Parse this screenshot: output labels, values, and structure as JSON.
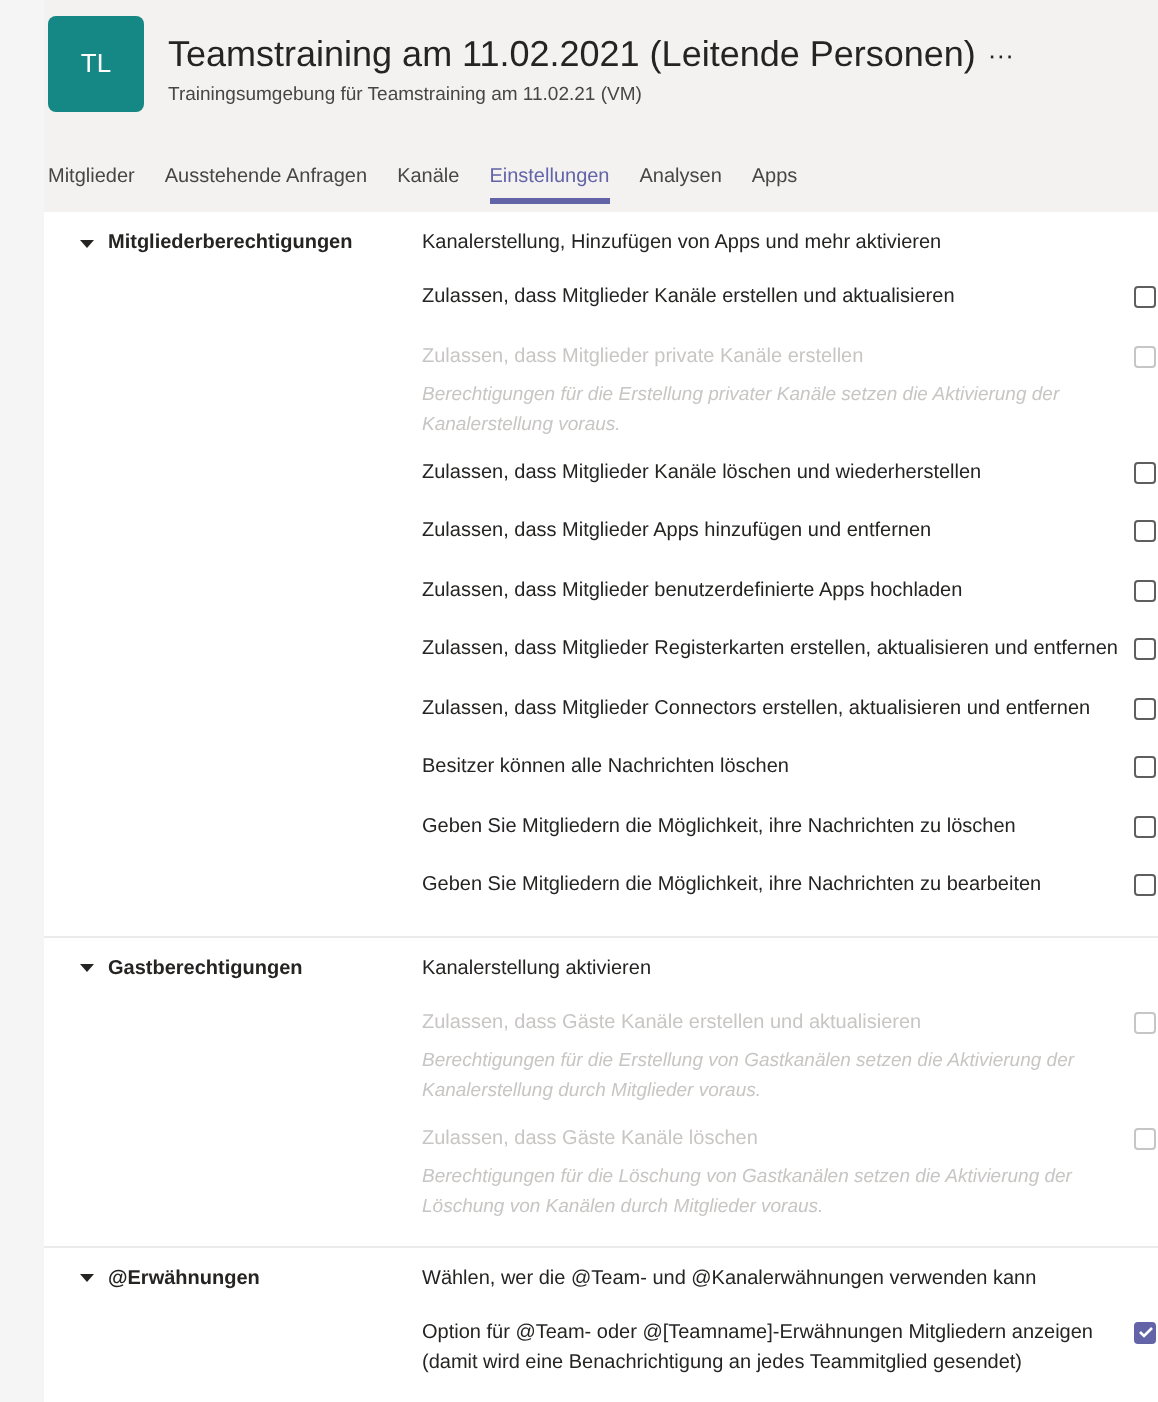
{
  "team": {
    "initials": "TL",
    "title": "Teamstraining am 11.02.2021 (Leitende Personen)",
    "more": "···",
    "subtitle": "Trainingsumgebung für Teamstraining am 11.02.21 (VM)"
  },
  "tabs": [
    {
      "label": "Mitglieder",
      "selected": false
    },
    {
      "label": "Ausstehende Anfragen",
      "selected": false
    },
    {
      "label": "Kanäle",
      "selected": false
    },
    {
      "label": "Einstellungen",
      "selected": true
    },
    {
      "label": "Analysen",
      "selected": false
    },
    {
      "label": "Apps",
      "selected": false
    }
  ],
  "sections": [
    {
      "title": "Mitgliederberechtigungen",
      "expanded": true,
      "description": "Kanalerstellung, Hinzufügen von Apps und mehr aktivieren",
      "settings": [
        {
          "label": "Zulassen, dass Mitglieder Kanäle erstellen und aktualisieren",
          "disabled": false,
          "checked": false
        },
        {
          "label": "Zulassen, dass Mitglieder private Kanäle erstellen",
          "note": "Berechtigungen für die Erstellung privater Kanäle setzen die Aktivierung der Kanalerstellung voraus.",
          "disabled": true,
          "checked": false
        },
        {
          "label": "Zulassen, dass Mitglieder Kanäle löschen und wiederherstellen",
          "disabled": false,
          "checked": false
        },
        {
          "label": "Zulassen, dass Mitglieder Apps hinzufügen und entfernen",
          "disabled": false,
          "checked": false
        },
        {
          "label": "Zulassen, dass Mitglieder benutzerdefinierte Apps hochladen",
          "disabled": false,
          "checked": false
        },
        {
          "label": "Zulassen, dass Mitglieder Registerkarten erstellen, aktualisieren und entfernen",
          "disabled": false,
          "checked": false
        },
        {
          "label": "Zulassen, dass Mitglieder Connectors erstellen, aktualisieren und entfernen",
          "disabled": false,
          "checked": false
        },
        {
          "label": "Besitzer können alle Nachrichten löschen",
          "disabled": false,
          "checked": false
        },
        {
          "label": "Geben Sie Mitgliedern die Möglichkeit, ihre Nachrichten zu löschen",
          "disabled": false,
          "checked": false
        },
        {
          "label": "Geben Sie Mitgliedern die Möglichkeit, ihre Nachrichten zu bearbeiten",
          "disabled": false,
          "checked": false
        }
      ]
    },
    {
      "title": "Gastberechtigungen",
      "expanded": true,
      "description": "Kanalerstellung aktivieren",
      "settings": [
        {
          "label": "Zulassen, dass Gäste Kanäle erstellen und aktualisieren",
          "note": "Berechtigungen für die Erstellung von Gastkanälen setzen die Aktivierung der Kanalerstellung durch Mitglieder voraus.",
          "disabled": true,
          "checked": false
        },
        {
          "label": "Zulassen, dass Gäste Kanäle löschen",
          "note": "Berechtigungen für die Löschung von Gastkanälen setzen die Aktivierung der Löschung von Kanälen durch Mitglieder voraus.",
          "disabled": true,
          "checked": false
        }
      ]
    },
    {
      "title": "@Erwähnungen",
      "expanded": true,
      "description": "Wählen, wer die @Team- und @Kanalerwähnungen verwenden kann",
      "settings": [
        {
          "label": "Option für @Team- oder @[Teamname]-Erwähnungen Mitgliedern anzeigen (damit wird eine Benachrichtigung an jedes Teammitglied gesendet)",
          "disabled": false,
          "checked": true
        }
      ]
    }
  ]
}
